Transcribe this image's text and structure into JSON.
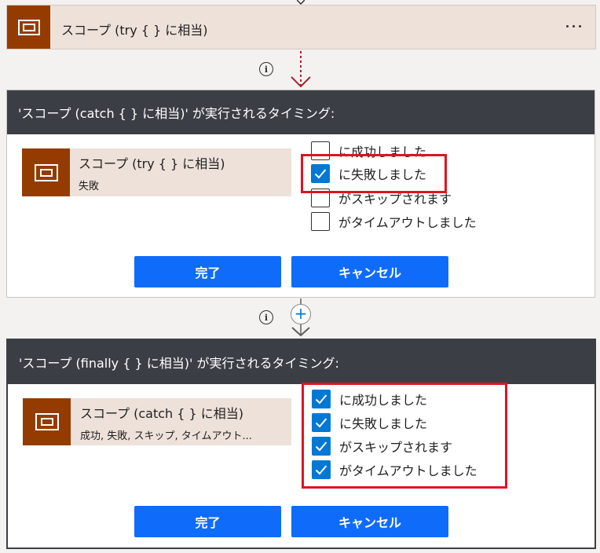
{
  "scope_try": {
    "title": "スコープ (try { } に相当)",
    "more_label": "…"
  },
  "info_symbol": "i",
  "plus_symbol": "+",
  "catch_panel": {
    "header": "'スコープ (catch { } に相当)' が実行されるタイミング:",
    "card_title": "スコープ (try { } に相当)",
    "card_sub": "失敗",
    "options": [
      {
        "label": "に成功しました",
        "checked": false
      },
      {
        "label": "に失敗しました",
        "checked": true
      },
      {
        "label": "がスキップされます",
        "checked": false
      },
      {
        "label": "がタイムアウトしました",
        "checked": false
      }
    ],
    "done_label": "完了",
    "cancel_label": "キャンセル"
  },
  "finally_panel": {
    "header": "'スコープ (finally { } に相当)' が実行されるタイミング:",
    "card_title": "スコープ (catch { } に相当)",
    "card_sub": "成功, 失敗, スキップ, タイムアウト...",
    "options": [
      {
        "label": "に成功しました",
        "checked": true
      },
      {
        "label": "に失敗しました",
        "checked": true
      },
      {
        "label": "がスキップされます",
        "checked": true
      },
      {
        "label": "がタイムアウトしました",
        "checked": true
      }
    ],
    "done_label": "完了",
    "cancel_label": "キャンセル"
  },
  "colors": {
    "scope_accent": "#943c00",
    "scope_bg": "#ede1da",
    "header_bg": "#3b3f45",
    "primary_button": "#0f6cfa",
    "checkbox_checked": "#0078d4",
    "highlight": "#e0131f",
    "connector_dashed": "#a4262c"
  },
  "icons": {
    "scope": "scope-icon",
    "more": "more-dots-icon",
    "info": "info-icon",
    "add": "add-step-icon",
    "check": "checkmark-icon",
    "arrow": "down-arrow-icon"
  }
}
